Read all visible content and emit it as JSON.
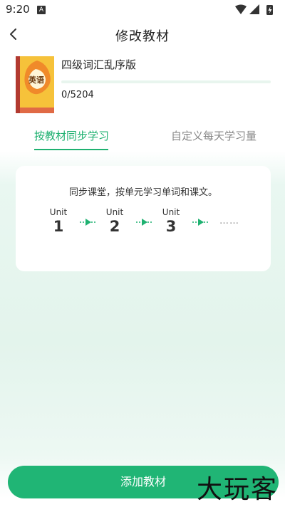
{
  "status_bar": {
    "time": "9:20",
    "app_indicator": "A",
    "icons": [
      "wifi-icon",
      "signal-icon",
      "battery-charging-icon"
    ]
  },
  "nav": {
    "title": "修改教材",
    "back_icon": "chevron-left-icon"
  },
  "book": {
    "cover_label": "英语",
    "title": "四级词汇乱序版",
    "progress_text": "0/5204",
    "progress_fraction": 0
  },
  "tabs": [
    {
      "label": "按教材同步学习",
      "active": true
    },
    {
      "label": "自定义每天学习量",
      "active": false
    }
  ],
  "info_card": {
    "description": "同步课堂，按单元学习单词和课文。",
    "units": [
      {
        "label": "Unit",
        "number": "1"
      },
      {
        "label": "Unit",
        "number": "2"
      },
      {
        "label": "Unit",
        "number": "3"
      }
    ],
    "ellipsis": "……"
  },
  "add_button": {
    "label": "添加教材"
  },
  "watermark": "大玩客",
  "colors": {
    "accent": "#1fb171",
    "button": "#20b575",
    "card": "#ffffff",
    "background": "#e6f5ee"
  }
}
